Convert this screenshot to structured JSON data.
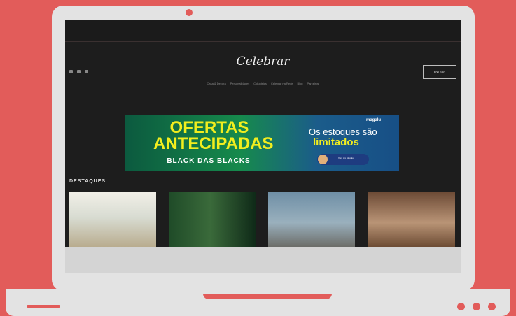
{
  "colors": {
    "background": "#e25c5a",
    "laptop": "#e3e3e3",
    "screen": "#1d1d1d",
    "accent_yellow": "#f2ee1e"
  },
  "site": {
    "logo": "Celebrar",
    "signin_label": "ENTRAR",
    "social_icons": [
      "instagram-icon",
      "facebook-icon",
      "youtube-icon"
    ],
    "nav": [
      "Casa & Decora",
      "Personalidades",
      "Colunistas",
      "Celebrar na Rede",
      "Blog",
      "Parceiros"
    ]
  },
  "banner": {
    "headline_1": "OFERTAS",
    "headline_2": "ANTECIPADAS",
    "tagline": "BLACK DAS BLACKS",
    "brand": "magalu",
    "side_text_1": "Os estoques são",
    "side_text_2": "limitados",
    "cta": "Vem pro Magalu"
  },
  "featured": {
    "title": "DESTAQUES"
  }
}
